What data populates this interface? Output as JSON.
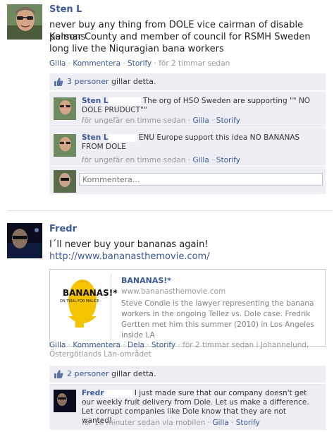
{
  "post1": {
    "author": "Sten L",
    "message_lines": [
      "never buy any thing from DOLE vice cairman of disable persons",
      "Kalmar County and member of council for RSMH Sweden",
      "long live the Niquragian bana workers"
    ],
    "actions": {
      "like": "Gilla",
      "comment": "Kommentera",
      "story": "Storify",
      "time": "för 2 timmar sedan"
    },
    "likes": {
      "count": "3 personer",
      "suffix": "gillar detta."
    },
    "comments": [
      {
        "author": "Sten L",
        "text": "The org of HSO Sweden are supporting \"\" NO DOLE PRUDUCT\"\"",
        "time": "för ungefär en timme sedan",
        "like": "Gilla",
        "story": "Storify"
      },
      {
        "author": "Sten L",
        "text": "ENU Europe support this idea NO BANANAS FROM DOLE",
        "time": "för ungefär en timme sedan",
        "like": "Gilla",
        "story": "Storify"
      }
    ],
    "comment_placeholder": "Kommentera..."
  },
  "post2": {
    "author": "Fredr",
    "message": "I´ll never buy your bananas again!",
    "link": "http://www.bananasthemovie.com/",
    "share": {
      "title": "BANANAS!*",
      "url": "www.bananasthemovie.com",
      "desc": "Steve Condie is the lawyer representing the banana workers in the ongoing Tellez vs. Dole case. Fredrik Gertten met him this summer (2010) in Los Angeles inside LA",
      "poster_text": "BANANAS!*",
      "poster_sub": "ON TRIAL FOR MALICE"
    },
    "actions": {
      "like": "Gilla",
      "comment": "Kommentera",
      "share": "Dela",
      "story": "Storify",
      "time": "för 2 timmar sedan i Johannelund,",
      "place": "Östergötlands Län-området"
    },
    "likes": {
      "count": "2 personer",
      "suffix": "gillar detta."
    },
    "comment": {
      "author": "Fredr",
      "text": "I just made sure that our company doesn't get our weekly fruit delivery from Dole. Let us make a difference. Let corrupt companies like Dole know that they are not wanted!",
      "time": "för 16 minuter sedan via mobilen",
      "like": "Gilla",
      "story": "Storify"
    }
  },
  "colors": {
    "link": "#3b5998",
    "panel": "#edeff4",
    "meta": "#999999"
  }
}
